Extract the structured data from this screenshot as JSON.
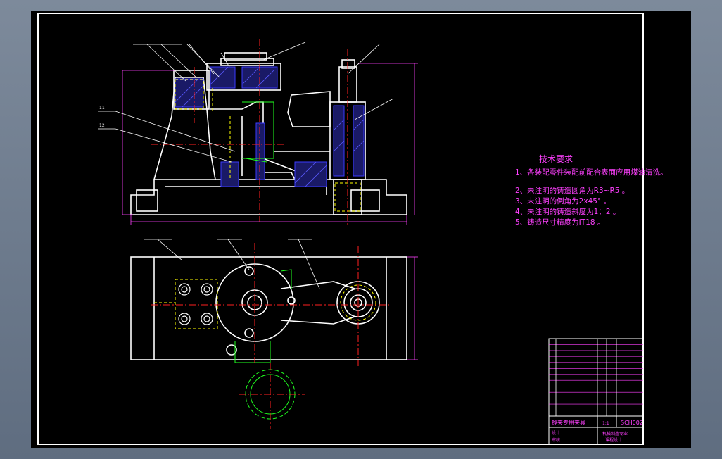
{
  "colors": {
    "background": "#000000",
    "viewport": "#6e7c8e",
    "outline": "#ffffff",
    "hatch": "#3a3aff",
    "centerline": "#ff2020",
    "hidden": "#ffff00",
    "dimension": "#ff40ff",
    "auxiliary": "#20ff20",
    "callout": "#ffffff",
    "fill_part": "#7777ff"
  },
  "tech_requirements": {
    "title": "技术要求",
    "items": [
      "1、各装配零件装配前配合表面应用煤油清洗。",
      "2、未注明的铸造圆角为R3~R5 。",
      "3、未注明的倒角为2x45° 。",
      "4、未注明的铸造斜度为1：2 。",
      "5、铸造尺寸精度为IT18 。"
    ]
  },
  "title_block": {
    "drawing_name": "镗夹专用夹具",
    "drawing_code": "SCH002",
    "school_line1": "机械制造专业",
    "school_line2": "课程设计",
    "designer_label": "设计",
    "check_label": "审核",
    "scale": "1:1"
  },
  "parts_list_rows": 13
}
